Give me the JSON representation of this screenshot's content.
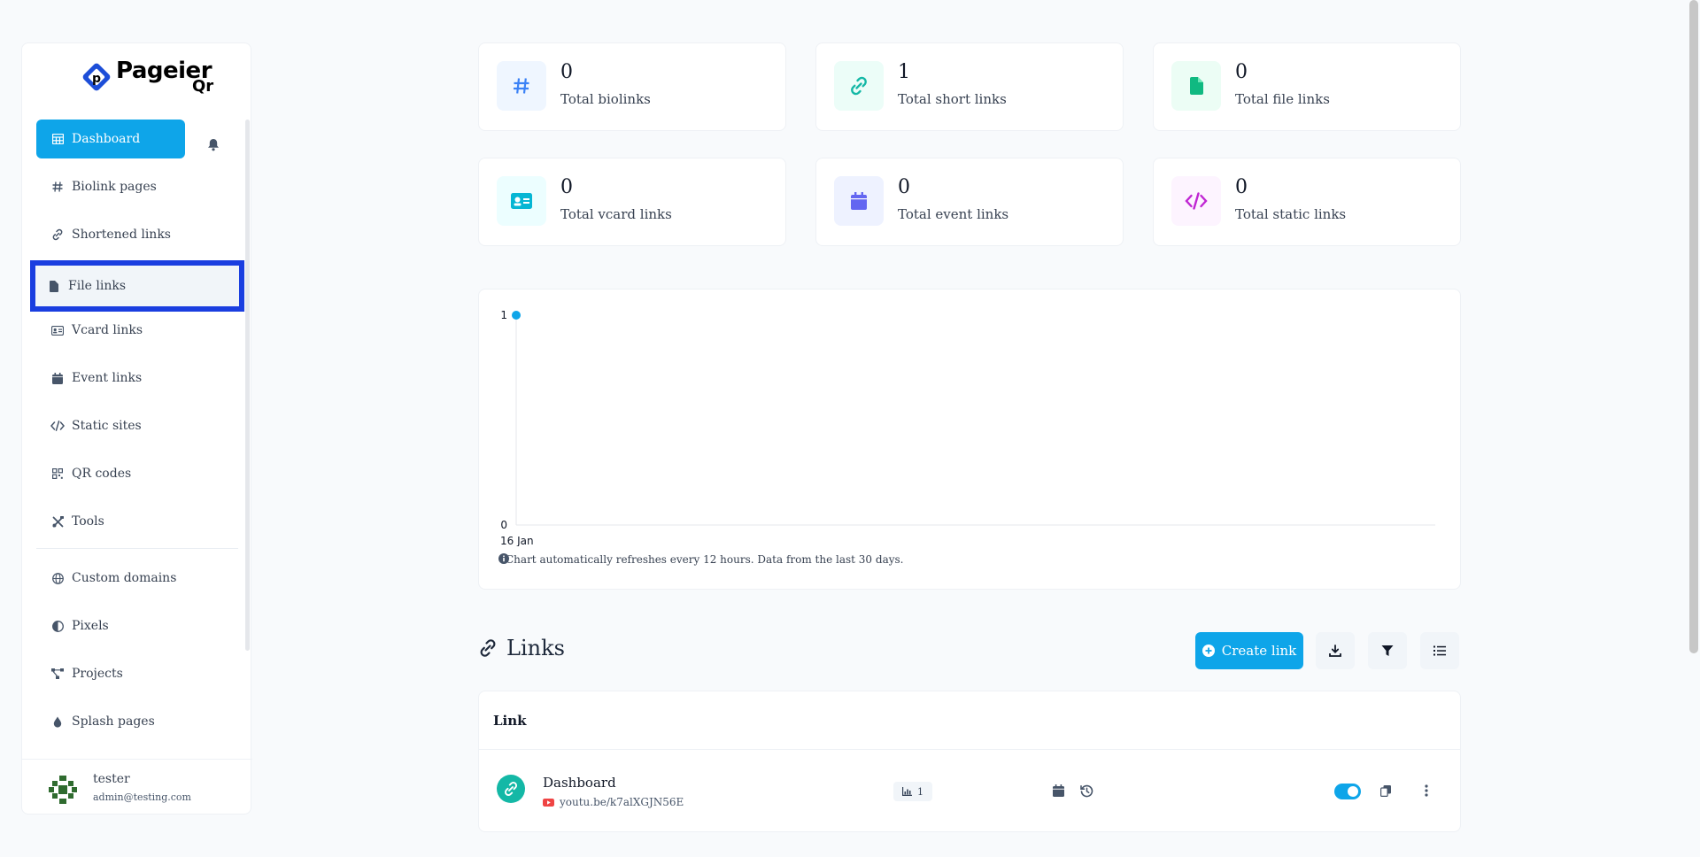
{
  "brand": {
    "name": "Pageier",
    "sub": "Qr"
  },
  "sidebar": {
    "items": [
      {
        "label": "Dashboard",
        "icon": "table-icon"
      },
      {
        "label": "Biolink pages",
        "icon": "hash-icon"
      },
      {
        "label": "Shortened links",
        "icon": "link-icon"
      },
      {
        "label": "File links",
        "icon": "file-icon"
      },
      {
        "label": "Vcard links",
        "icon": "id-card-icon"
      },
      {
        "label": "Event links",
        "icon": "calendar-icon"
      },
      {
        "label": "Static sites",
        "icon": "code-icon"
      },
      {
        "label": "QR codes",
        "icon": "qrcode-icon"
      },
      {
        "label": "Tools",
        "icon": "tools-icon"
      },
      {
        "label": "Custom domains",
        "icon": "globe-icon"
      },
      {
        "label": "Pixels",
        "icon": "adjust-icon"
      },
      {
        "label": "Projects",
        "icon": "project-diagram-icon"
      },
      {
        "label": "Splash pages",
        "icon": "droplet-icon"
      }
    ]
  },
  "user": {
    "name": "tester",
    "email": "admin@testing.com"
  },
  "stats": [
    {
      "value": "0",
      "label": "Total biolinks",
      "color": "#3b82f6"
    },
    {
      "value": "1",
      "label": "Total short links",
      "color": "#14b8a6"
    },
    {
      "value": "0",
      "label": "Total file links",
      "color": "#10b981"
    },
    {
      "value": "0",
      "label": "Total vcard links",
      "color": "#06b6d4"
    },
    {
      "value": "0",
      "label": "Total event links",
      "color": "#6366f1"
    },
    {
      "value": "0",
      "label": "Total static links",
      "color": "#c026d3"
    }
  ],
  "chart_data": {
    "type": "line",
    "x": [
      "16 Jan"
    ],
    "series": [
      {
        "values": [
          1
        ]
      }
    ],
    "ylim": [
      0,
      1
    ],
    "yticks": [
      "0",
      "1"
    ],
    "xticks": [
      "16 Jan"
    ],
    "grid": false
  },
  "chart_note": "Chart automatically refreshes every 12 hours. Data from the last 30 days.",
  "links": {
    "title": "Links",
    "create_label": "Create link",
    "column": "Link",
    "row": {
      "title": "Dashboard",
      "url": "youtu.be/k7alXGJN56E",
      "clicks": "1",
      "enabled": true
    }
  },
  "colors": {
    "accent": "#0ea5e9",
    "highlight": "#1a3ee0"
  }
}
